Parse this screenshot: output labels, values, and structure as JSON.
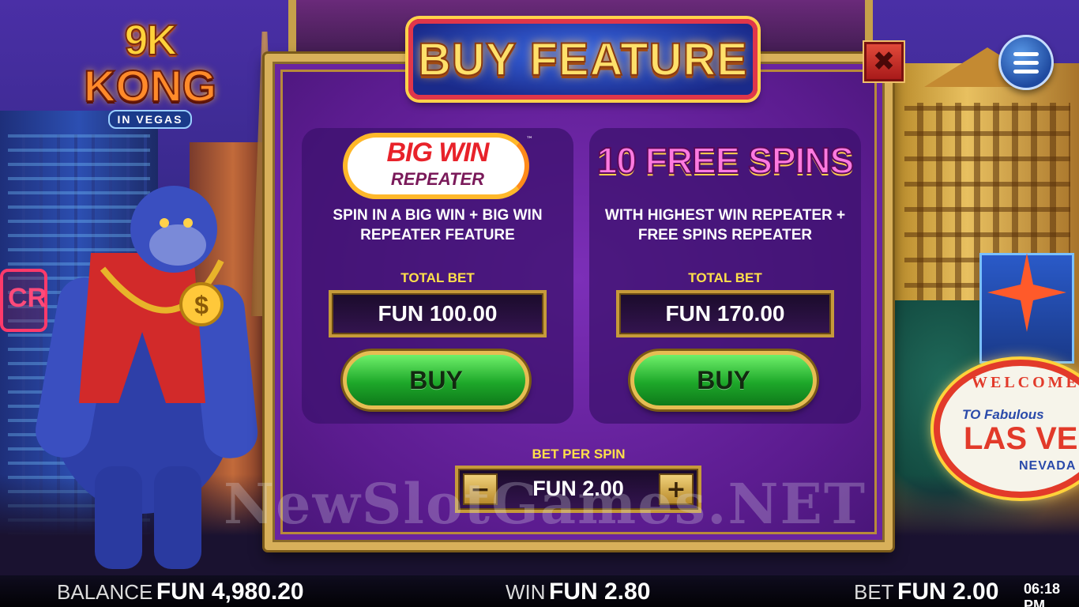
{
  "game": {
    "logo_top": "9K",
    "logo_name": "KONG",
    "logo_sub": "IN VEGAS"
  },
  "popup": {
    "title": "BUY FEATURE",
    "close_glyph": "✖",
    "options": [
      {
        "logo_line1": "BIG WIN",
        "logo_line2": "REPEATER",
        "logo_tm": "™",
        "description": "SPIN IN A BIG WIN + BIG WIN REPEATER FEATURE",
        "total_bet_label": "TOTAL BET",
        "total_bet_value": "FUN 100.00",
        "buy_label": "BUY"
      },
      {
        "logo_line1": "10 FREE SPINS",
        "description": "WITH HIGHEST WIN REPEATER + FREE SPINS REPEATER",
        "total_bet_label": "TOTAL BET",
        "total_bet_value": "FUN 170.00",
        "buy_label": "BUY"
      }
    ],
    "bet_per_spin": {
      "label": "BET PER SPIN",
      "value": "FUN 2.00",
      "minus": "−",
      "plus": "+"
    }
  },
  "watermark": "NewSlotGames.NET",
  "vegas_sign": {
    "welcome": "WELCOME",
    "to": "TO Fabulous",
    "las": "LAS VE",
    "nevada": "NEVADA"
  },
  "status_bar": {
    "balance_label": "BALANCE",
    "balance_value": "FUN 4,980.20",
    "win_label": "WIN",
    "win_value": "FUN 2.80",
    "bet_label": "BET",
    "bet_value": "FUN 2.00",
    "clock": "06:18 PM"
  },
  "icons": {
    "menu": "hamburger-menu-icon",
    "close": "close-icon"
  },
  "colors": {
    "popup_purple": "#6a24a0",
    "gold_border": "#d8b05a",
    "buy_green": "#1ea82a",
    "label_yellow": "#ffe04a"
  }
}
